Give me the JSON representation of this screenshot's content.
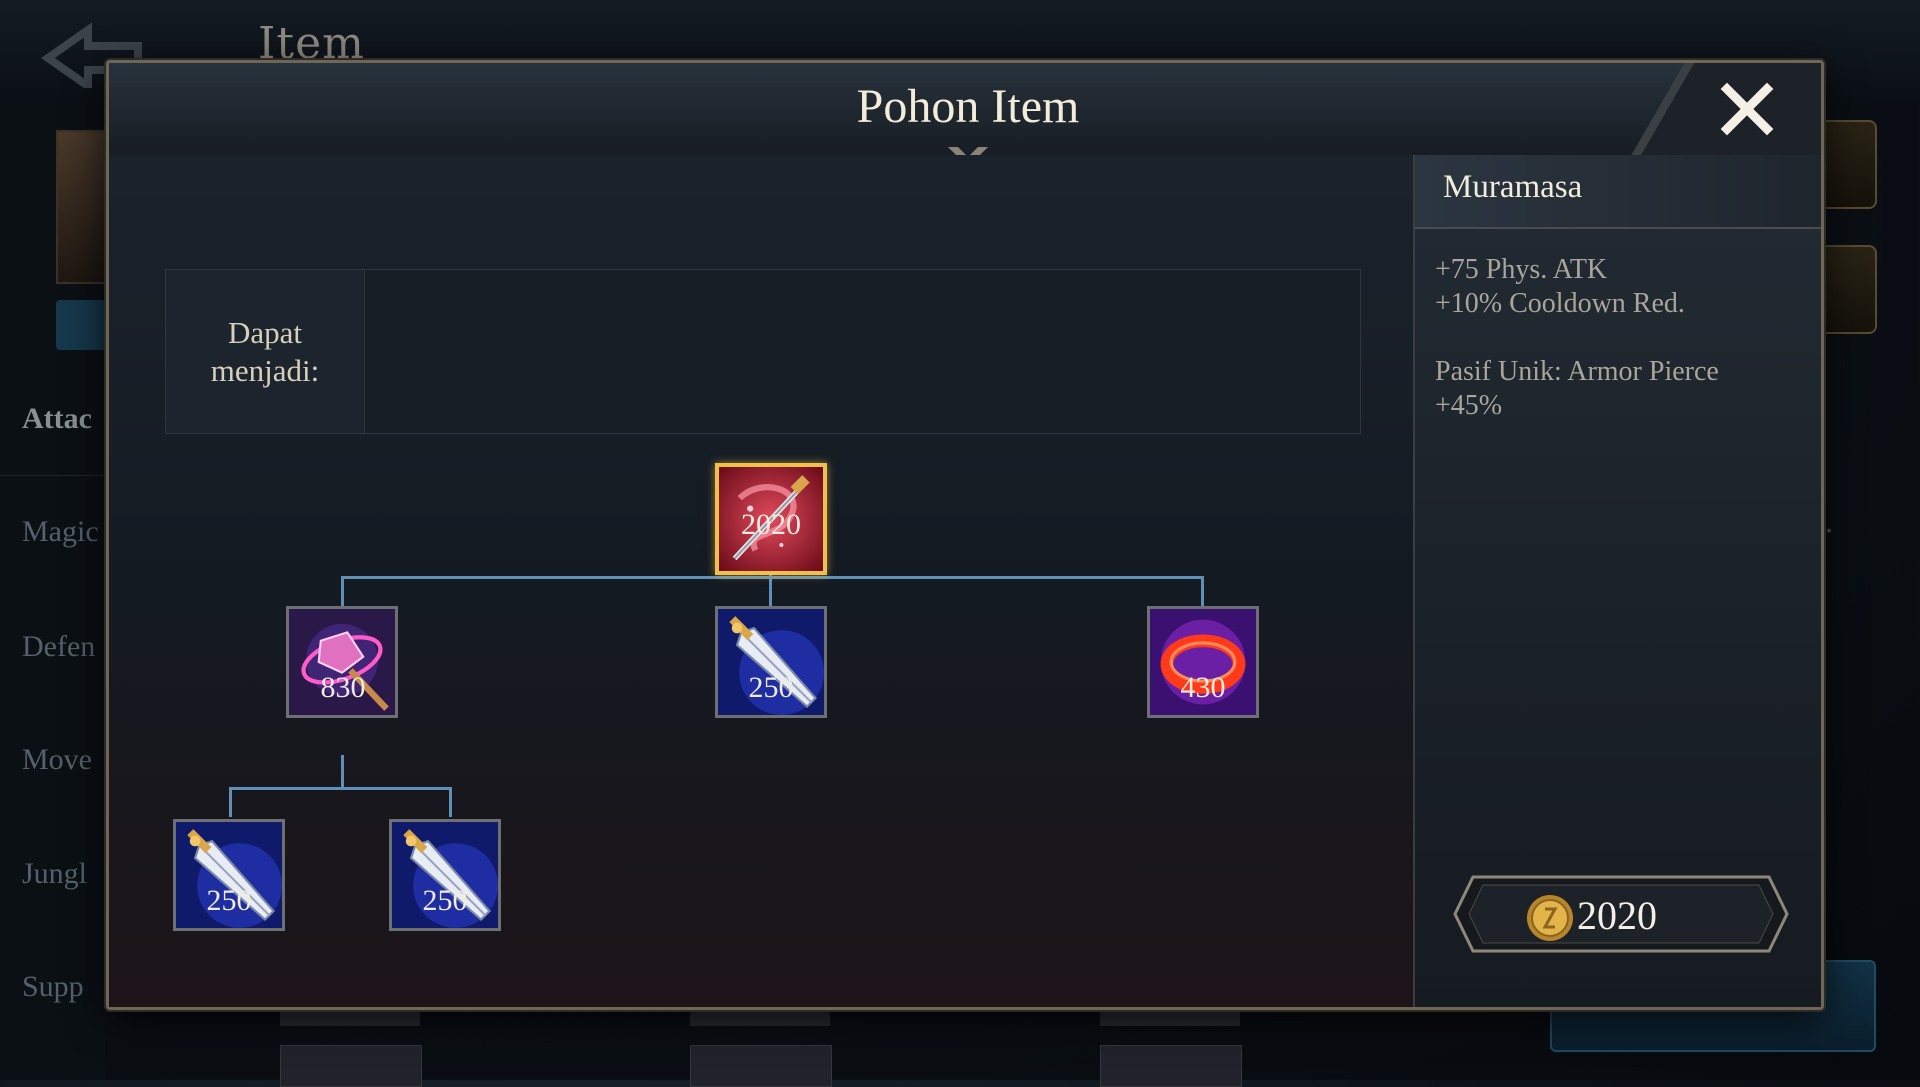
{
  "background": {
    "title": "Item",
    "categories": [
      "Attac",
      "Magic",
      "Defen",
      "Move",
      "Jungl",
      "Supp"
    ],
    "right_partial_text": "d."
  },
  "modal": {
    "title": "Pohon Item",
    "become_label": "Dapat menjadi:",
    "tree": {
      "root": {
        "name": "Muramasa",
        "price": "2020",
        "icon": "muramasa-icon"
      },
      "children": [
        {
          "price": "830",
          "icon": "magic-staff-icon",
          "children": [
            {
              "price": "250",
              "icon": "dagger-icon"
            },
            {
              "price": "250",
              "icon": "dagger-icon"
            }
          ]
        },
        {
          "price": "250",
          "icon": "dagger-icon"
        },
        {
          "price": "430",
          "icon": "fire-ring-icon"
        }
      ]
    },
    "details": {
      "name": "Muramasa",
      "stats": [
        "+75 Phys. ATK",
        "+10% Cooldown Red."
      ],
      "passive": [
        "Pasif Unik: Armor Pierce",
        "+45%"
      ],
      "cost": "2020"
    }
  },
  "colors": {
    "selected_border": "#f0c04a",
    "tree_line": "#5e8fb8",
    "title_text": "#f3ecd8"
  }
}
